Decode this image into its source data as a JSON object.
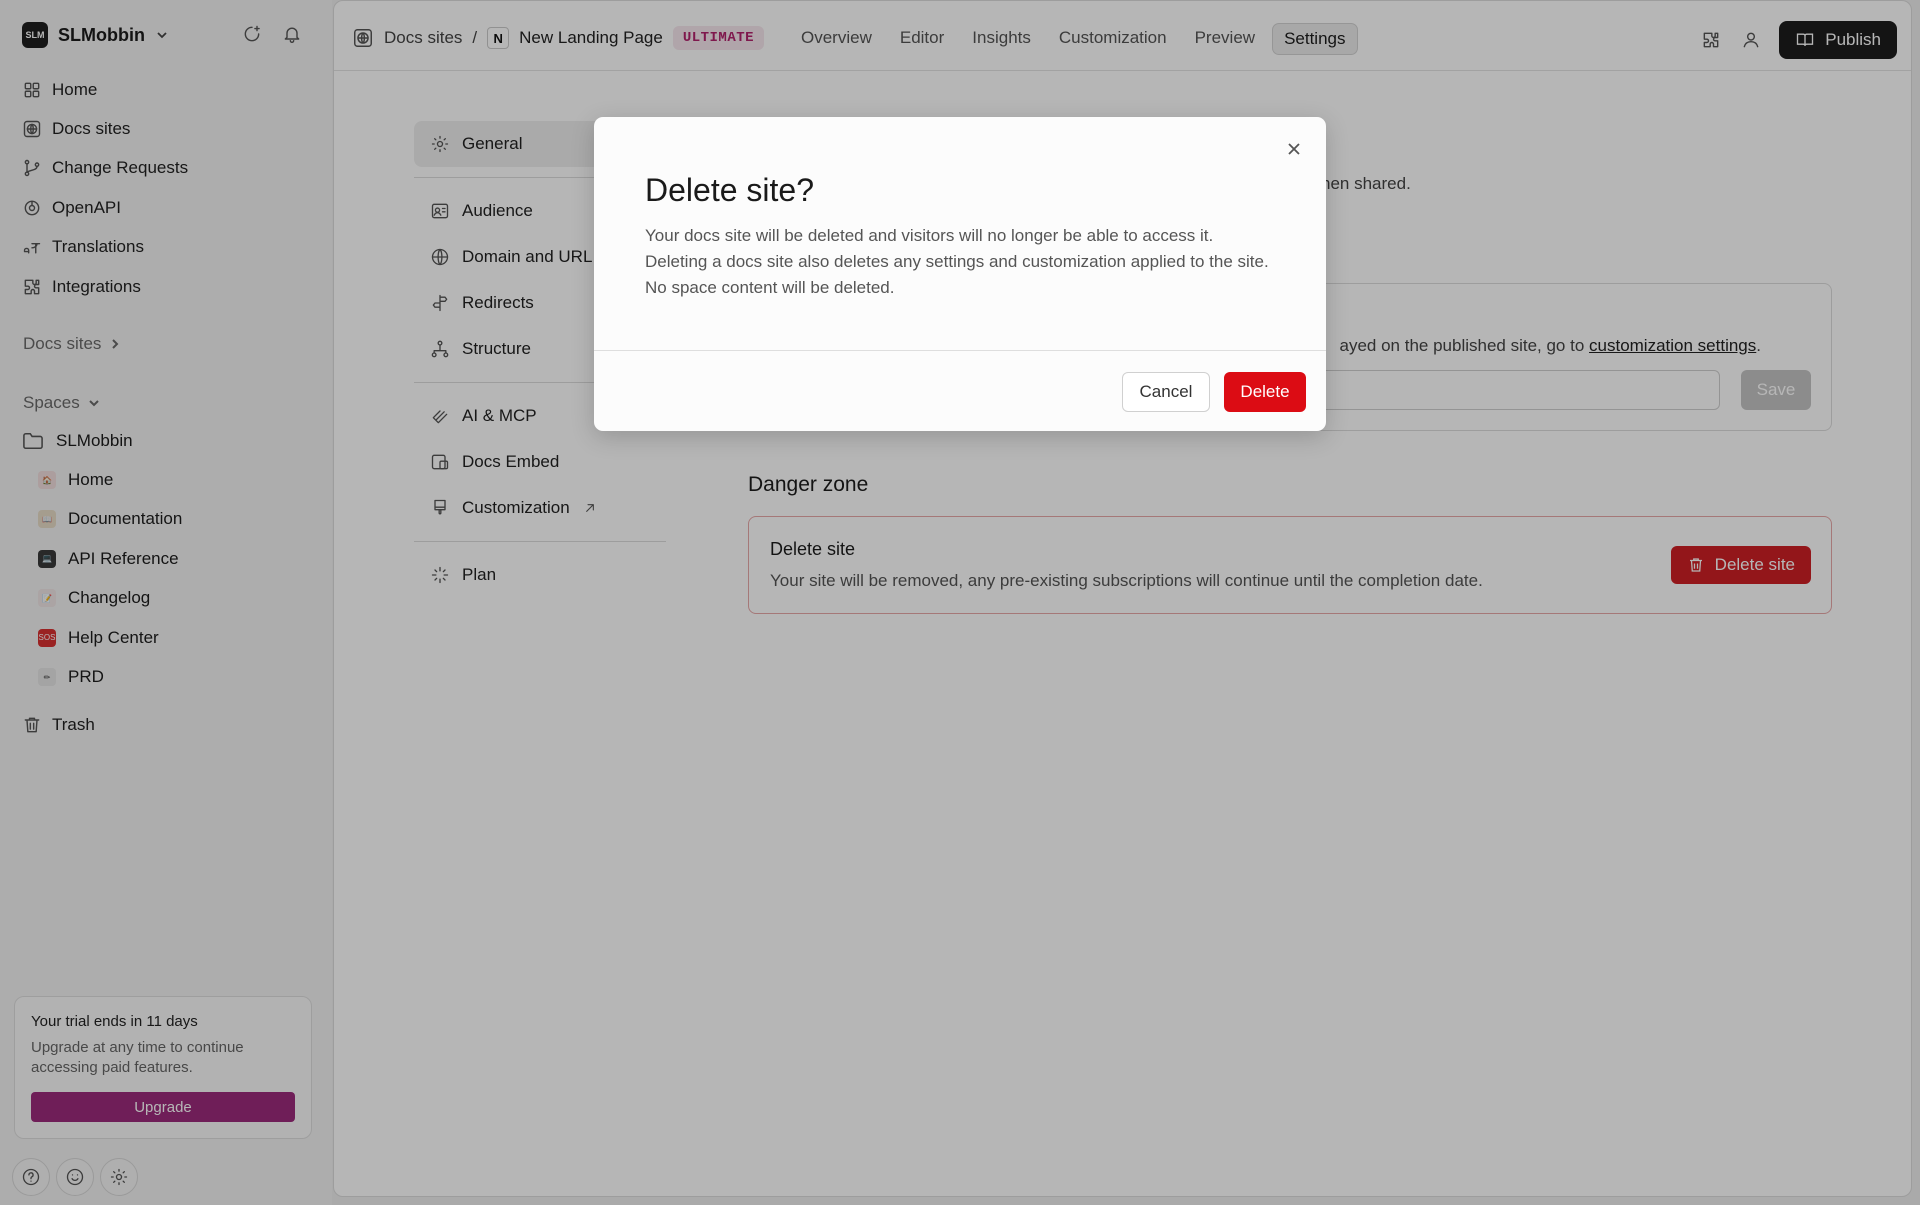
{
  "sidebar": {
    "org_name": "SLMobbin",
    "org_logo_text": "SLM",
    "nav": [
      {
        "label": "Home",
        "icon": "grid-icon"
      },
      {
        "label": "Docs sites",
        "icon": "globe-icon"
      },
      {
        "label": "Change Requests",
        "icon": "branch-icon"
      },
      {
        "label": "OpenAPI",
        "icon": "openapi-icon"
      },
      {
        "label": "Translations",
        "icon": "translate-icon"
      },
      {
        "label": "Integrations",
        "icon": "puzzle-icon"
      }
    ],
    "docs_sites_label": "Docs sites",
    "spaces_label": "Spaces",
    "space_root": "SLMobbin",
    "spaces": [
      {
        "label": "Home",
        "icon": "house-emoji"
      },
      {
        "label": "Documentation",
        "icon": "book-emoji"
      },
      {
        "label": "API Reference",
        "icon": "laptop-emoji"
      },
      {
        "label": "Changelog",
        "icon": "memo-emoji"
      },
      {
        "label": "Help Center",
        "icon": "sos-emoji"
      },
      {
        "label": "PRD",
        "icon": "pencil-emoji"
      }
    ],
    "trash_label": "Trash",
    "trial": {
      "title": "Your trial ends in 11 days",
      "text": "Upgrade at any time to continue accessing paid features.",
      "button": "Upgrade"
    }
  },
  "topbar": {
    "crumb_root": "Docs sites",
    "crumb_sep": "/",
    "site_logo": "N",
    "site_name": "New Landing Page",
    "plan_badge": "ULTIMATE",
    "tabs": [
      "Overview",
      "Editor",
      "Insights",
      "Customization",
      "Preview",
      "Settings"
    ],
    "active_tab": "Settings",
    "publish_label": "Publish"
  },
  "settings_nav": {
    "items": [
      "General",
      "Audience",
      "Domain and URL",
      "Redirects",
      "Structure",
      "AI & MCP",
      "Docs Embed",
      "Customization",
      "Plan"
    ],
    "active": "General"
  },
  "general": {
    "hint_partial": "hen shared.",
    "card_text_partial": "ayed on the published site, go to ",
    "card_link": "customization settings",
    "card_text_end": ".",
    "save_label": "Save"
  },
  "danger_zone": {
    "title": "Danger zone",
    "card_title": "Delete site",
    "card_text": "Your site will be removed, any pre-existing subscriptions will continue until the completion date.",
    "button": "Delete site"
  },
  "modal": {
    "title": "Delete site?",
    "body": "Your docs site will be deleted and visitors will no longer be able to access it. Deleting a docs site also deletes any settings and customization applied to the site. No space content will be deleted.",
    "cancel": "Cancel",
    "confirm": "Delete"
  },
  "colors": {
    "brand_upgrade": "#9c2a7c",
    "danger": "#dc0c14",
    "badge_text": "#b3226d"
  }
}
